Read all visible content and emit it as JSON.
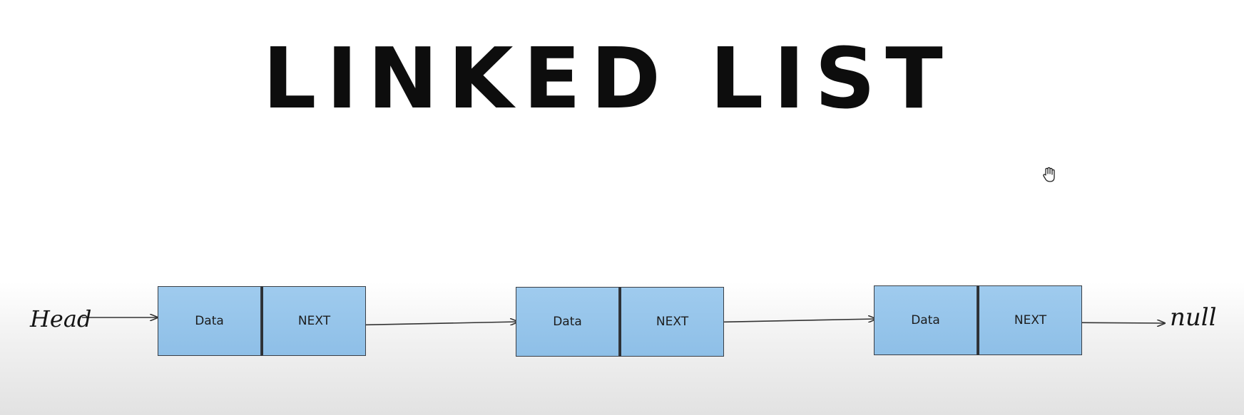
{
  "title": "LINKED LIST",
  "head_label": "Head",
  "null_label": "null",
  "nodes": [
    {
      "data_label": "Data",
      "next_label": "NEXT"
    },
    {
      "data_label": "Data",
      "next_label": "NEXT"
    },
    {
      "data_label": "Data",
      "next_label": "NEXT"
    }
  ],
  "colors": {
    "node_fill": "#9fcbee",
    "node_border": "#3a3f46",
    "arrow": "#333333"
  },
  "icons": {
    "cursor": "hand-cursor-icon"
  }
}
